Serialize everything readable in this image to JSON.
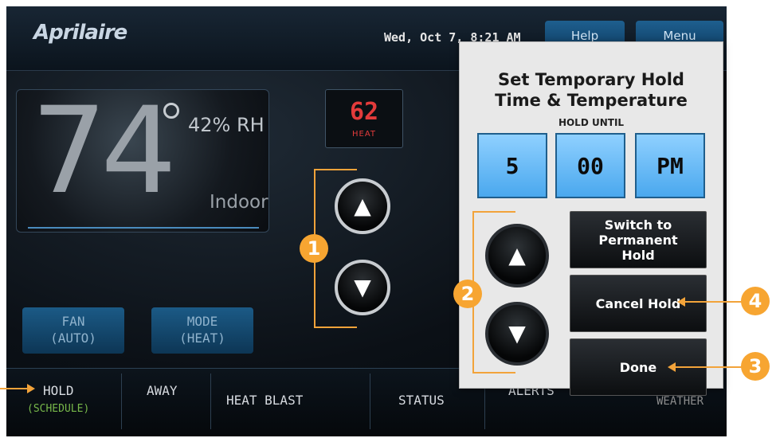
{
  "header": {
    "brand": "Aprilaire",
    "datetime": "Wed, Oct 7, 8:21 AM",
    "help_label": "Help",
    "menu_label": "Menu"
  },
  "indoor": {
    "temperature": "74",
    "humidity": "42% RH",
    "label": "Indoor"
  },
  "setpoint": {
    "value": "62",
    "mode": "HEAT"
  },
  "controls": {
    "up_icon": "triangle-up-icon",
    "down_icon": "triangle-down-icon"
  },
  "bottom_buttons": {
    "fan_label": "FAN",
    "fan_state": "(AUTO)",
    "mode_label": "MODE",
    "mode_state": "(HEAT)"
  },
  "tabs": [
    {
      "label": "HOLD",
      "sub": "(SCHEDULE)"
    },
    {
      "label": "AWAY"
    },
    {
      "label": "HEAT BLAST"
    },
    {
      "label": "STATUS"
    },
    {
      "label": "ALERTS"
    },
    {
      "label": "WEATHER"
    }
  ],
  "hold_dialog": {
    "title_line1": "Set Temporary Hold",
    "title_line2": "Time & Temperature",
    "subtitle": "HOLD UNTIL",
    "hour": "5",
    "minute": "00",
    "ampm": "PM",
    "switch_label_1": "Switch to",
    "switch_label_2": "Permanent",
    "switch_label_3": "Hold",
    "cancel_label": "Cancel Hold",
    "done_label": "Done"
  },
  "callouts": {
    "one": "1",
    "two": "2",
    "three": "3",
    "four": "4"
  },
  "colors": {
    "accent_orange": "#f7a531",
    "button_blue": "#1b5a86",
    "time_blue": "#4aa8ee",
    "setpoint_red": "#e33b3b",
    "schedule_green": "#77b84a"
  }
}
